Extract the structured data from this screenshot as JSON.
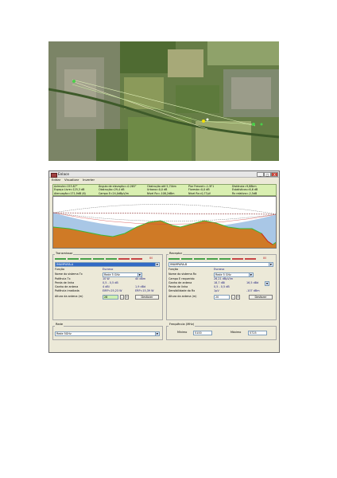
{
  "window": {
    "title": "Enlace",
    "menu": [
      "Editar",
      "Visualizar",
      "Inverter"
    ],
    "minimize": "_",
    "maximize": "□",
    "close": "X"
  },
  "info_bar": {
    "row1": [
      "Azimute=153.87°",
      "Ângulo de elevação=-0.265°",
      "Obstrução até 5,74km",
      "Pior Fresnel=-1.5F1",
      "Distância=9,88km"
    ],
    "row2": [
      "Espaço Livre=125,3 dB",
      "Obstrução=29,4 dB",
      "Urbano=0,0 dB",
      "Floresta=0,0 dB",
      "Estatísticas=6,6 dB"
    ],
    "row3": [
      "Atenuação=171,9dB (6)",
      "Campo E=24,0dBµV/m",
      "Nível Rx=-108,2dBm",
      "Nível Rx=0,77µV",
      "Rx relativo=-2,5dB"
    ]
  },
  "transmitter": {
    "group_label": "Transmissor",
    "level_value": "80",
    "station": "IMAMPARÁ-A",
    "funcao_label": "Função",
    "funcao_value": "Escravo",
    "system_label": "Nome do sistema Tx",
    "system_value": "Rede 5 GHz",
    "potencia_label": "Potência Tx",
    "potencia_w": "10 W",
    "potencia_dbm": "40 dBm",
    "perda_label": "Perda de linha",
    "perda_value": "0,5 - 0,5 dB",
    "ganho_label": "Ganho de antena",
    "ganho_dbi": "4 dBi",
    "ganho_dbd": "1,9 dBd",
    "irradiada_label": "Potência irradiada",
    "eirp": "EIRP=25,23 W",
    "erp": "ERP=15,39 W",
    "altura_label": "Altura da antena (m)",
    "altura_value": "28",
    "desfazer": "Desfazer"
  },
  "receiver": {
    "group_label": "Receptor",
    "level_value": "80",
    "station": "IMAMPARA-B",
    "funcao_label": "Função",
    "funcao_value": "Escravo",
    "system_label": "Nome do sistema Rx",
    "system_value": "Rede 5 GHz",
    "campo_label": "Campo E requerido",
    "campo_value": "26,21 dBµV/m",
    "ganho_label": "Ganho de antena",
    "ganho_dbi": "18,7 dBi",
    "ganho_dbd": "16,5 dBd",
    "perda_label": "Perda de linha",
    "perda_value": "0,5 - 0,5 dB",
    "sens_label": "Sensibilidade do Rx",
    "sens_uv": "1µV",
    "sens_dbm": "-107 dBm",
    "altura_label": "Altura da antena (m)",
    "altura_value": "20",
    "desfazer": "Desfazer"
  },
  "rede": {
    "label": "Rede",
    "value": "Rede 5GHz"
  },
  "frequencia": {
    "label": "Frequência (MHz)",
    "min_label": "Mínimo",
    "min_value": "5100",
    "max_label": "Máximo",
    "max_value": "5725"
  }
}
